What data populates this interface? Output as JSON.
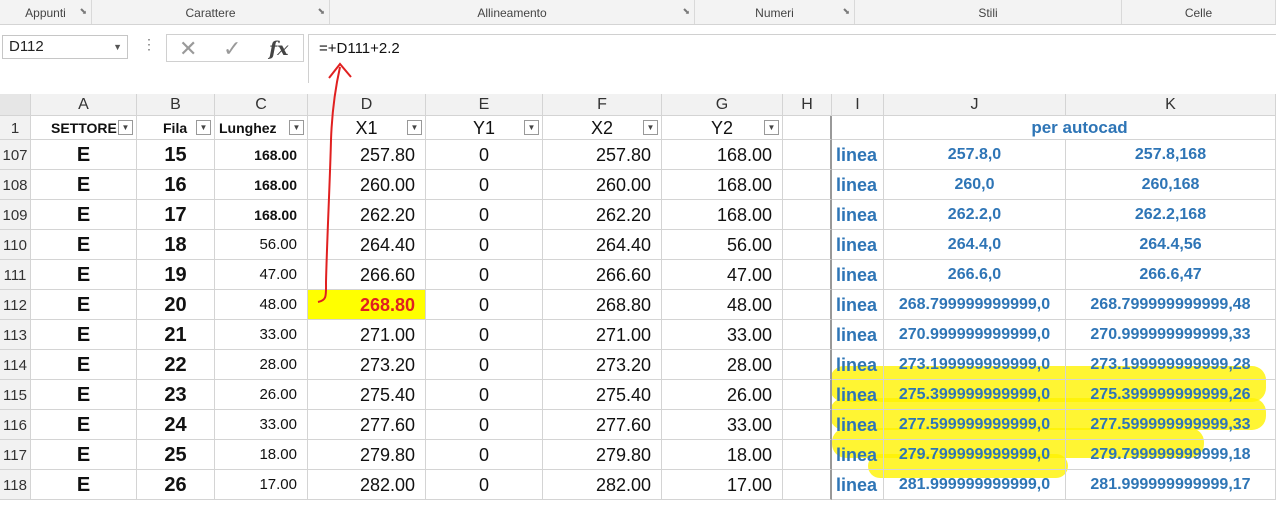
{
  "ribbon": {
    "groups": [
      {
        "label": "Appunti",
        "launcher": "⬊"
      },
      {
        "label": "Carattere",
        "launcher": "⬊"
      },
      {
        "label": "Allineamento",
        "launcher": "⬊"
      },
      {
        "label": "Numeri",
        "launcher": "⬊"
      },
      {
        "label": "Stili",
        "launcher": ""
      },
      {
        "label": "Celle",
        "launcher": ""
      }
    ]
  },
  "formula_bar": {
    "name_box": "D112",
    "separator": "⋮",
    "cancel_icon": "✕",
    "enter_icon": "✓",
    "fx_icon": "fx",
    "formula": "=+D111+2.2"
  },
  "columns": [
    "A",
    "B",
    "C",
    "D",
    "E",
    "F",
    "G",
    "H",
    "I",
    "J",
    "K"
  ],
  "header_row": {
    "row_number": "1",
    "a": "SETTORE",
    "b": "Fila",
    "c": "Lunghez",
    "d": "X1",
    "e": "Y1",
    "f": "X2",
    "g": "Y2",
    "jk": "per autocad"
  },
  "rows": [
    {
      "n": "107",
      "a": "E",
      "b": "15",
      "c": "168.00",
      "d": "257.80",
      "e": "0",
      "f": "257.80",
      "g": "168.00",
      "i": "linea",
      "j": "257.8,0",
      "k": "257.8,168"
    },
    {
      "n": "108",
      "a": "E",
      "b": "16",
      "c": "168.00",
      "d": "260.00",
      "e": "0",
      "f": "260.00",
      "g": "168.00",
      "i": "linea",
      "j": "260,0",
      "k": "260,168"
    },
    {
      "n": "109",
      "a": "E",
      "b": "17",
      "c": "168.00",
      "d": "262.20",
      "e": "0",
      "f": "262.20",
      "g": "168.00",
      "i": "linea",
      "j": "262.2,0",
      "k": "262.2,168"
    },
    {
      "n": "110",
      "a": "E",
      "b": "18",
      "c": "56.00",
      "d": "264.40",
      "e": "0",
      "f": "264.40",
      "g": "56.00",
      "i": "linea",
      "j": "264.4,0",
      "k": "264.4,56"
    },
    {
      "n": "111",
      "a": "E",
      "b": "19",
      "c": "47.00",
      "d": "266.60",
      "e": "0",
      "f": "266.60",
      "g": "47.00",
      "i": "linea",
      "j": "266.6,0",
      "k": "266.6,47"
    },
    {
      "n": "112",
      "a": "E",
      "b": "20",
      "c": "48.00",
      "d": "268.80",
      "e": "0",
      "f": "268.80",
      "g": "48.00",
      "i": "linea",
      "j": "268.799999999999,0",
      "k": "268.799999999999,48"
    },
    {
      "n": "113",
      "a": "E",
      "b": "21",
      "c": "33.00",
      "d": "271.00",
      "e": "0",
      "f": "271.00",
      "g": "33.00",
      "i": "linea",
      "j": "270.999999999999,0",
      "k": "270.999999999999,33"
    },
    {
      "n": "114",
      "a": "E",
      "b": "22",
      "c": "28.00",
      "d": "273.20",
      "e": "0",
      "f": "273.20",
      "g": "28.00",
      "i": "linea",
      "j": "273.199999999999,0",
      "k": "273.199999999999,28"
    },
    {
      "n": "115",
      "a": "E",
      "b": "23",
      "c": "26.00",
      "d": "275.40",
      "e": "0",
      "f": "275.40",
      "g": "26.00",
      "i": "linea",
      "j": "275.399999999999,0",
      "k": "275.399999999999,26"
    },
    {
      "n": "116",
      "a": "E",
      "b": "24",
      "c": "33.00",
      "d": "277.60",
      "e": "0",
      "f": "277.60",
      "g": "33.00",
      "i": "linea",
      "j": "277.599999999999,0",
      "k": "277.599999999999,33"
    },
    {
      "n": "117",
      "a": "E",
      "b": "25",
      "c": "18.00",
      "d": "279.80",
      "e": "0",
      "f": "279.80",
      "g": "18.00",
      "i": "linea",
      "j": "279.799999999999,0",
      "k": "279.799999999999,18"
    },
    {
      "n": "118",
      "a": "E",
      "b": "26",
      "c": "17.00",
      "d": "282.00",
      "e": "0",
      "f": "282.00",
      "g": "17.00",
      "i": "linea",
      "j": "281.999999999999,0",
      "k": "281.999999999999,17"
    }
  ],
  "selected_cell": "D112",
  "colors": {
    "selection_fill": "#ffff00",
    "selection_text": "#e02020",
    "autocad_text": "#2e75b6",
    "highlighter": "#fff200",
    "annotation_arrow": "#e02020"
  }
}
